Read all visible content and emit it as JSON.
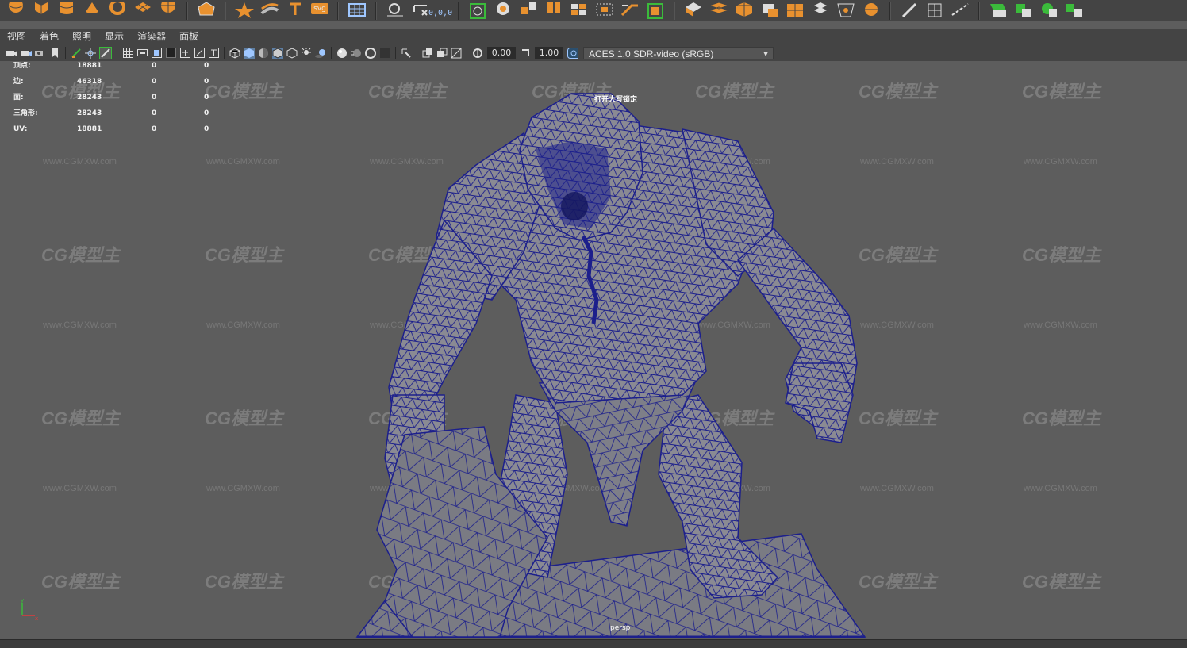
{
  "menu": {
    "items": [
      "视图",
      "着色",
      "照明",
      "显示",
      "渲染器",
      "面板"
    ]
  },
  "shelf": {
    "svg_label": "svg",
    "coord_label": "0,0,0",
    "accent": "#e8912f"
  },
  "toolbar": {
    "exposure_value": "0.00",
    "gamma_value": "1.00",
    "color_space": "ACES 1.0 SDR-video (sRGB)"
  },
  "hud": {
    "rows": [
      {
        "label": "顶点:",
        "v1": "18881",
        "v2": "0",
        "v3": "0"
      },
      {
        "label": "边:",
        "v1": "46318",
        "v2": "0",
        "v3": "0"
      },
      {
        "label": "面:",
        "v1": "28243",
        "v2": "0",
        "v3": "0"
      },
      {
        "label": "三角形:",
        "v1": "28243",
        "v2": "0",
        "v3": "0"
      },
      {
        "label": "UV:",
        "v1": "18881",
        "v2": "0",
        "v3": "0"
      }
    ]
  },
  "viewport": {
    "caps_message": "打开大写锁定",
    "camera_label": "persp",
    "axis_y": "y",
    "axis_x": "x",
    "watermark": "CG模型主",
    "watermark_url": "www.CGMXW.com",
    "wire_color": "#1c1f8c",
    "mesh_color": "#8a8a93"
  }
}
